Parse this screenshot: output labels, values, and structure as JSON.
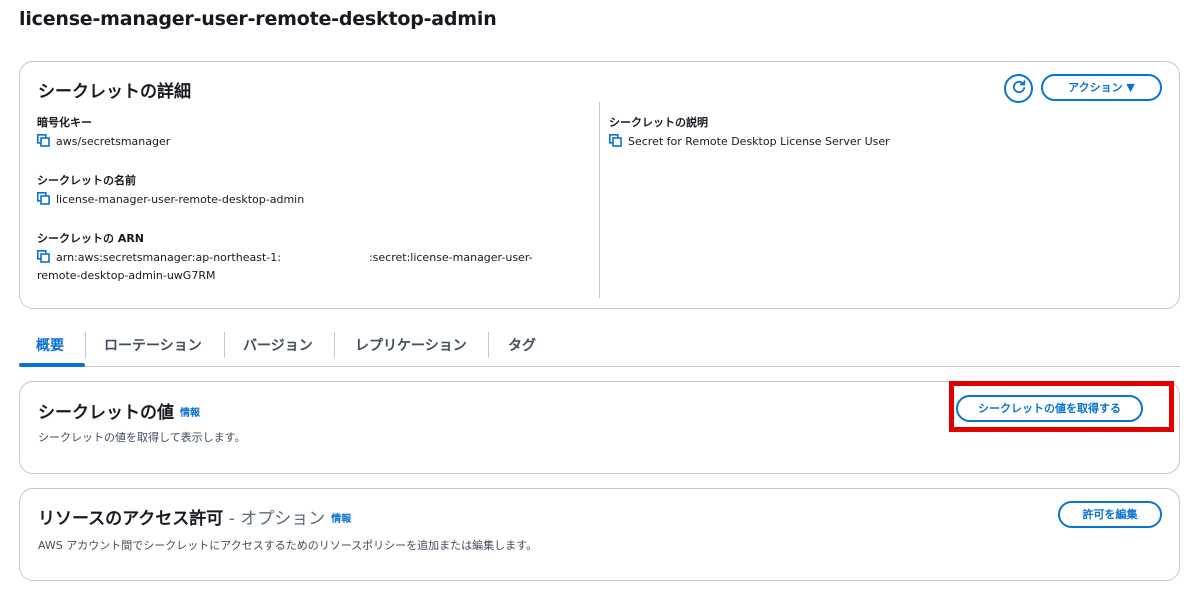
{
  "page": {
    "title": "license-manager-user-remote-desktop-admin"
  },
  "details": {
    "heading": "シークレットの詳細",
    "action_label": "アクション ▼",
    "encryption_key": {
      "label": "暗号化キー",
      "value": "aws/secretsmanager"
    },
    "secret_name": {
      "label": "シークレットの名前",
      "value": "license-manager-user-remote-desktop-admin"
    },
    "arn": {
      "label": "シークレットの ARN",
      "value_part1": "arn:aws:secretsmanager:ap-northeast-1:",
      "value_part2": ":secret:license-manager-user-",
      "value_line2": "remote-desktop-admin-uwG7RM"
    },
    "description": {
      "label": "シークレットの説明",
      "value": "Secret for Remote Desktop License Server User"
    }
  },
  "tabs": [
    "概要",
    "ローテーション",
    "バージョン",
    "レプリケーション",
    "タグ"
  ],
  "secret_value": {
    "heading": "シークレットの値",
    "info": "情報",
    "description": "シークレットの値を取得して表示します。",
    "button_label": "シークレットの値を取得する"
  },
  "resource_policy": {
    "heading": "リソースのアクセス許可",
    "heading_suffix": " - オプション",
    "info": "情報",
    "description": "AWS アカウント間でシークレットにアクセスするためのリソースポリシーを追加または編集します。",
    "button_label": "許可を編集"
  },
  "colors": {
    "accent": "#0972d3",
    "highlight": "#e00000",
    "border": "#c6c6cd"
  },
  "icons": {
    "copy": "copy-icon",
    "refresh": "refresh-icon"
  }
}
